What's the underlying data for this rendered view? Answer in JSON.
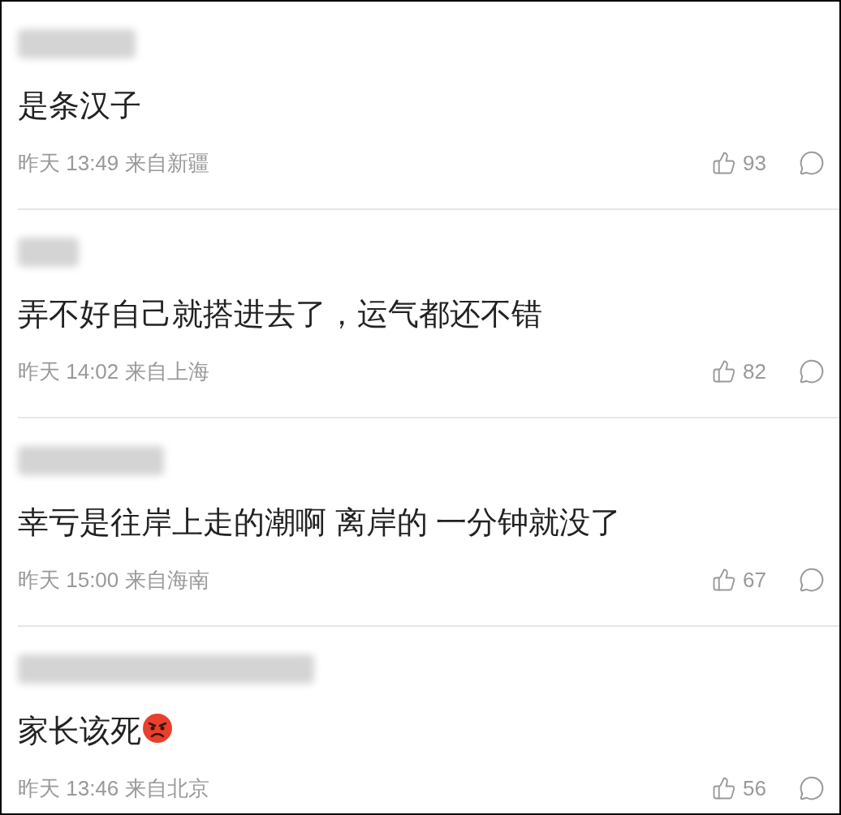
{
  "comments": [
    {
      "text": "是条汉子",
      "time": "昨天 13:49",
      "location": "来自新疆",
      "likes": "93"
    },
    {
      "text": "弄不好自己就搭进去了，运气都还不错",
      "time": "昨天 14:02",
      "location": "来自上海",
      "likes": "82"
    },
    {
      "text": "幸亏是往岸上走的潮啊 离岸的 一分钟就没了",
      "time": "昨天 15:00",
      "location": "来自海南",
      "likes": "67"
    },
    {
      "text": "家长该死",
      "angry_emoji": true,
      "time": "昨天 13:46",
      "location": "来自北京",
      "likes": "56"
    }
  ]
}
